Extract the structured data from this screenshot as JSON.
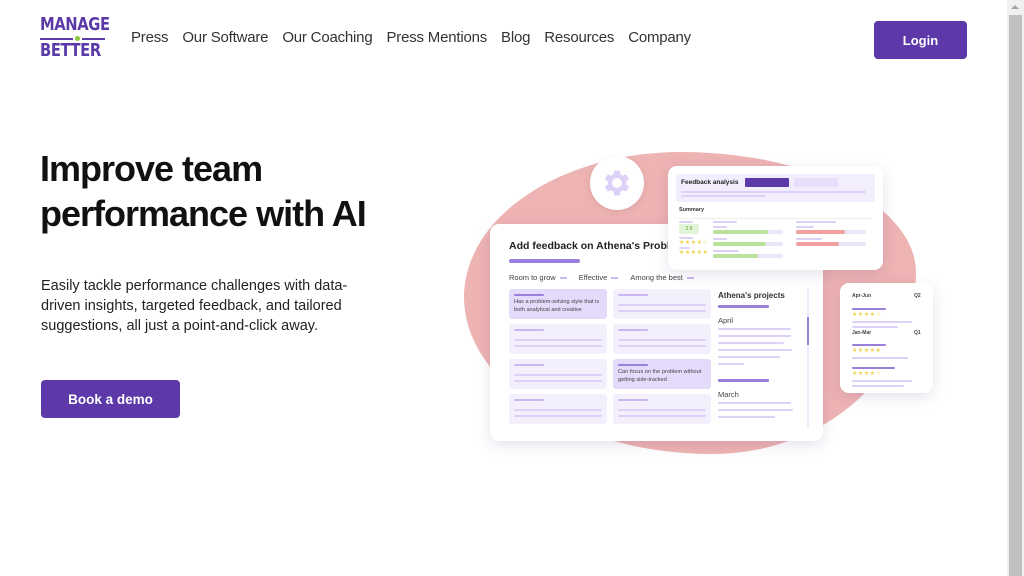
{
  "brand": {
    "logo_line1": "MANAGE",
    "logo_line2": "BETTER",
    "primary_color": "#5c38a8",
    "accent_dot_color": "#8cc63f"
  },
  "nav": {
    "items": [
      {
        "label": "Press"
      },
      {
        "label": "Our Software"
      },
      {
        "label": "Our Coaching"
      },
      {
        "label": "Press Mentions"
      },
      {
        "label": "Blog"
      },
      {
        "label": "Resources"
      },
      {
        "label": "Company"
      }
    ],
    "login_label": "Login"
  },
  "hero": {
    "title_line1": "Improve team",
    "title_line2": "performance with AI",
    "description": "Easily tackle performance challenges with data-driven insights, targeted feedback, and tailored suggestions, all just a point-and-click away.",
    "cta_label": "Book a demo"
  },
  "illustration": {
    "feedback_card": {
      "title": "Add feedback on Athena's Proble",
      "ratings": [
        "Room to grow",
        "Effective",
        "Among the best"
      ],
      "highlight_1": "Has a problem-solving style that is both analytical and creative",
      "highlight_2": "Can focus on the problem without getting side-tracked",
      "projects_title": "Athena's projects",
      "months": [
        "April",
        "March"
      ]
    },
    "analysis_card": {
      "title": "Feedback analysis",
      "summary_label": "Summary",
      "score": "3.8",
      "stars_1": "★★★★☆",
      "stars_2": "★★★★★",
      "green_bars": [
        0.78,
        0.76,
        0.64
      ],
      "red_bars": [
        0.7,
        0.62
      ],
      "green_color": "#b9e29a",
      "red_color": "#f2a0a0"
    },
    "quarter_card": {
      "period_1": "Apr-Jun",
      "quarter_1": "Q2",
      "period_2": "Jan-Mar",
      "quarter_2": "Q1",
      "stars_a": "★★★★☆",
      "stars_b": "★★★★★",
      "stars_c": "★★★★☆"
    }
  }
}
